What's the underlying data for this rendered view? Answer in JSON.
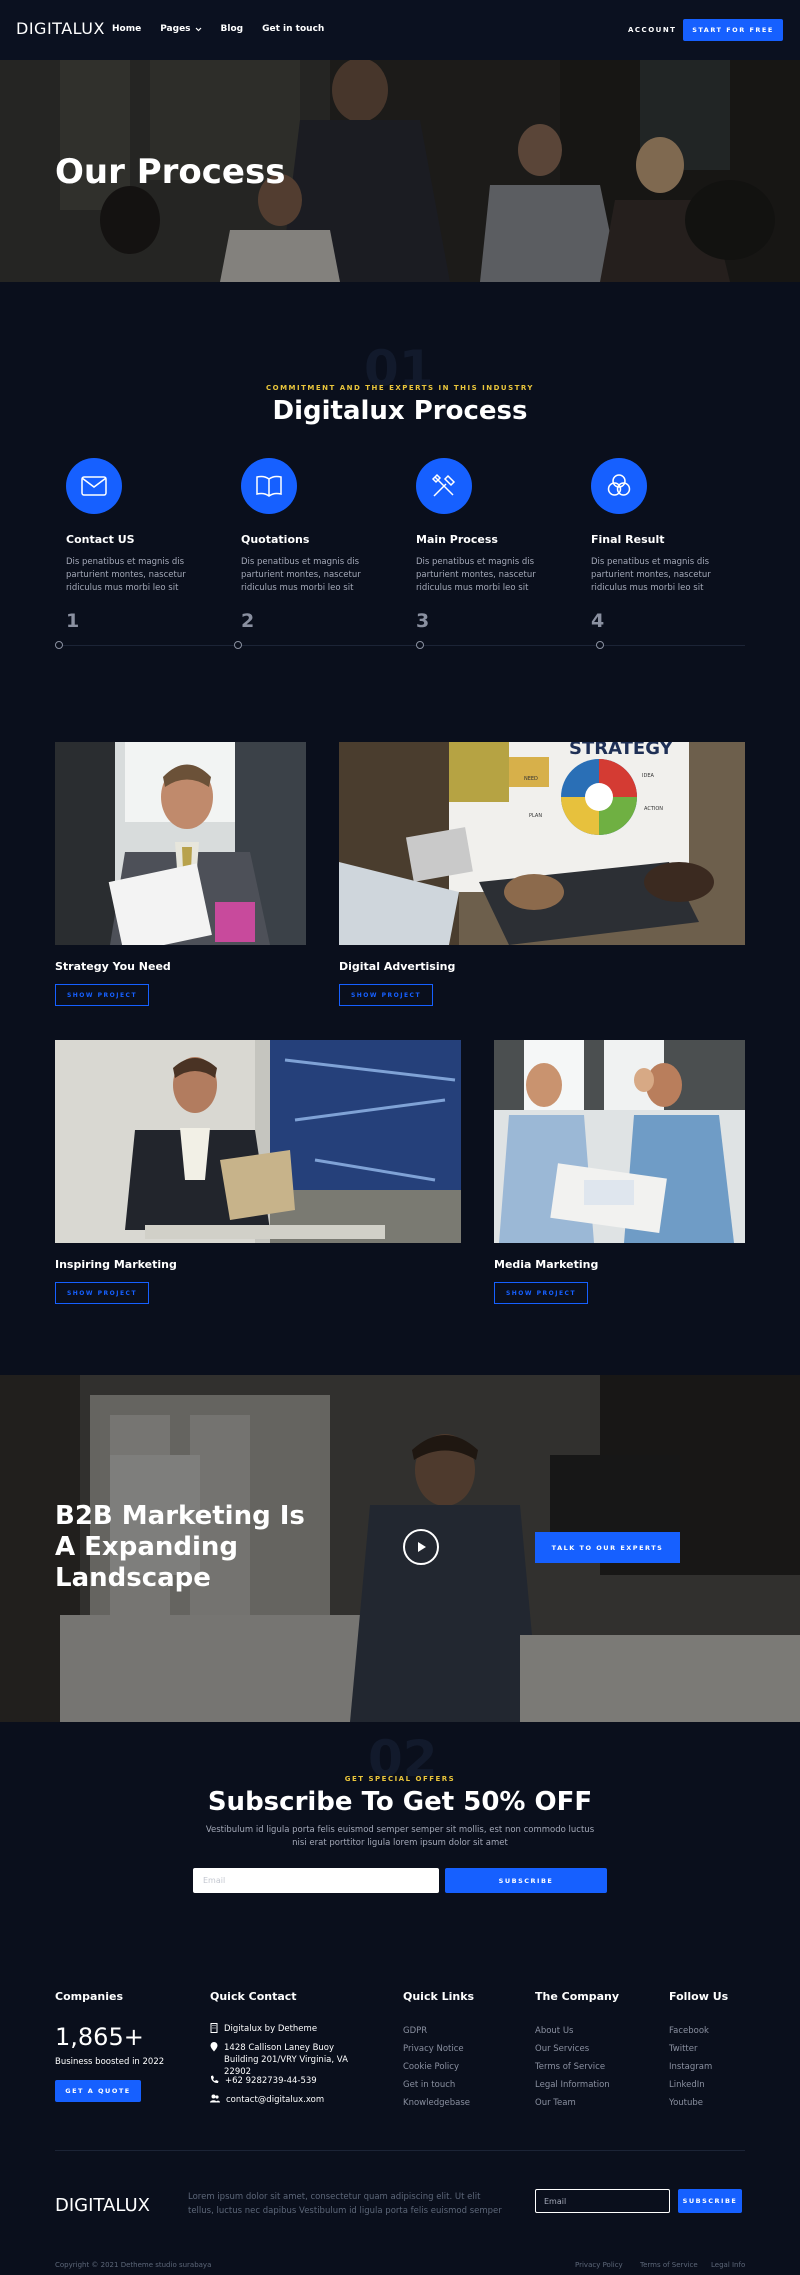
{
  "nav": {
    "logo": "DIGITALUX",
    "menu": [
      "Home",
      "Pages",
      "Blog",
      "Get in touch"
    ],
    "account": "ACCOUNT",
    "cta": "START FOR FREE"
  },
  "hero": {
    "title": "Our Process"
  },
  "process": {
    "bg_number": "01",
    "eyebrow": "COMMITMENT AND THE EXPERTS IN THIS INDUSTRY",
    "title": "Digitalux Process",
    "steps": [
      {
        "icon": "envelope-icon",
        "title": "Contact US",
        "text": "Dis penatibus et magnis dis parturient montes, nascetur ridiculus mus morbi leo sit",
        "num": "1"
      },
      {
        "icon": "book-icon",
        "title": "Quotations",
        "text": "Dis penatibus et magnis dis parturient montes, nascetur ridiculus mus morbi leo sit",
        "num": "2"
      },
      {
        "icon": "tools-icon",
        "title": "Main Process",
        "text": "Dis penatibus et magnis dis parturient montes, nascetur ridiculus mus morbi leo sit",
        "num": "3"
      },
      {
        "icon": "circles-icon",
        "title": "Final Result",
        "text": "Dis penatibus et magnis dis parturient montes, nascetur ridiculus mus morbi leo sit",
        "num": "4"
      }
    ]
  },
  "projects": {
    "button_label": "SHOW PROJECT",
    "items": [
      {
        "title": "Strategy You Need"
      },
      {
        "title": "Digital Advertising"
      },
      {
        "title": "Inspiring Marketing"
      },
      {
        "title": "Media Marketing"
      }
    ],
    "strategy_board": {
      "title": "STRATEGY",
      "words": [
        "NEED",
        "IDEA",
        "PLAN",
        "ACTION"
      ]
    }
  },
  "b2b": {
    "title": "B2B Marketing Is A Expanding Landscape",
    "cta": "TALK TO OUR EXPERTS"
  },
  "subscribe": {
    "bg_number": "02",
    "eyebrow": "GET SPECIAL OFFERS",
    "title": "Subscribe To Get 50% OFF",
    "text": "Vestibulum id ligula porta felis euismod semper semper sit mollis, est non commodo luctus nisi erat porttitor ligula lorem ipsum dolor sit amet",
    "placeholder": "Email",
    "button": "SUBSCRIBE"
  },
  "footer": {
    "companies": {
      "heading": "Companies",
      "count": "1,865+",
      "caption": "Business boosted in 2022",
      "button": "GET A QUOTE"
    },
    "contact": {
      "heading": "Quick Contact",
      "company": "Digitalux by Detheme",
      "address": "1428 Callison Laney Buoy Building 201/VRY Virginia, VA 22902",
      "phone": "+62 9282739-44-539",
      "email": "contact@digitalux.xom"
    },
    "quick_links": {
      "heading": "Quick Links",
      "items": [
        "GDPR",
        "Privacy Notice",
        "Cookie Policy",
        "Get in touch",
        "Knowledgebase"
      ]
    },
    "company": {
      "heading": "The Company",
      "items": [
        "About Us",
        "Our Services",
        "Terms of Service",
        "Legal Information",
        "Our Team"
      ]
    },
    "follow": {
      "heading": "Follow Us",
      "items": [
        "Facebook",
        "Twitter",
        "Instagram",
        "LinkedIn",
        "Youtube"
      ]
    },
    "logo": "DIGITALUX",
    "lorem": "Lorem ipsum dolor sit amet, consectetur quam adipiscing elit. Ut elit tellus, luctus nec dapibus Vestibulum id ligula porta felis euismod semper",
    "email_placeholder": "Email",
    "subscribe": "SUBSCRIBE",
    "copyright": "Copyright © 2021 Detheme studio surabaya",
    "legal": [
      "Privacy Policy",
      "Terms of Service",
      "Legal Info"
    ]
  }
}
